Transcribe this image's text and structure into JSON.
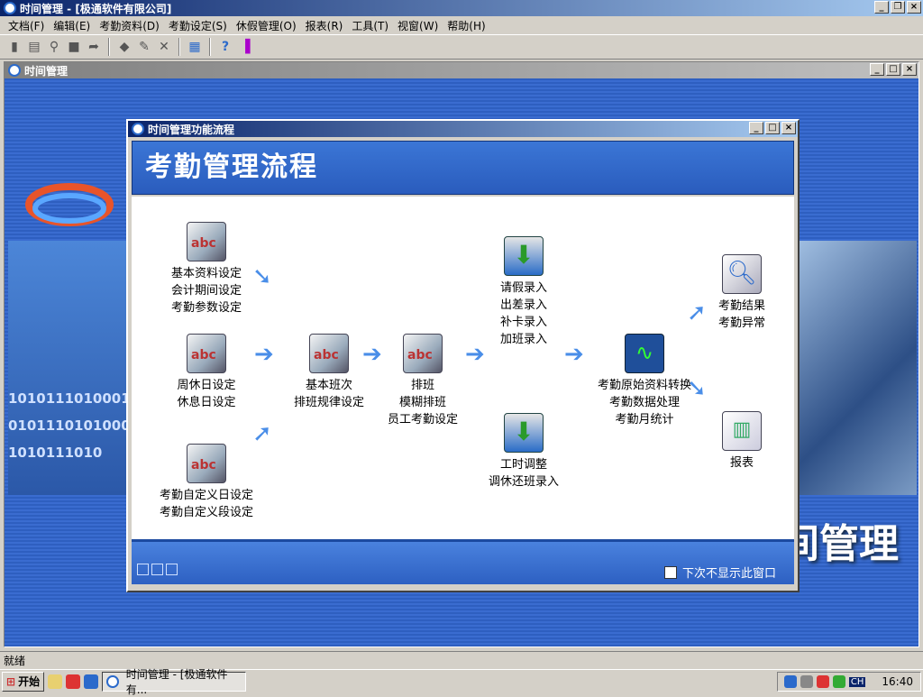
{
  "app": {
    "title": "时间管理 - [极通软件有限公司]"
  },
  "menu": [
    "文档(F)",
    "编辑(E)",
    "考勤资料(D)",
    "考勤设定(S)",
    "休假管理(O)",
    "报表(R)",
    "工具(T)",
    "视窗(W)",
    "帮助(H)"
  ],
  "mdi": {
    "title": "时间管理",
    "bg_text": "间管理",
    "binary": [
      "1010111010001",
      "0101110101000",
      "1010111010"
    ]
  },
  "dialog": {
    "title": "时间管理功能流程",
    "banner": "考勤管理流程",
    "nodes": {
      "basic": [
        "基本资料设定",
        "会计期间设定",
        "考勤参数设定"
      ],
      "weekly": [
        "周休日设定",
        "休息日设定"
      ],
      "custom": [
        "考勤自定义日设定",
        "考勤自定义段设定"
      ],
      "shift": [
        "基本班次",
        "排班规律设定"
      ],
      "schedule": [
        "排班",
        "模糊排班",
        "员工考勤设定"
      ],
      "leave": [
        "请假录入",
        "出差录入",
        "补卡录入",
        "加班录入"
      ],
      "adjust": [
        "工时调整",
        "调休还班录入"
      ],
      "process": [
        "考勤原始资料转换",
        "考勤数据处理",
        "考勤月统计"
      ],
      "result": [
        "考勤结果",
        "考勤异常"
      ],
      "report": [
        "报表"
      ]
    },
    "checkbox_label": "下次不显示此窗口"
  },
  "status": "就绪",
  "taskbar": {
    "start": "开始",
    "task": "时间管理 - [极通软件有...",
    "lang": "CH",
    "time": "16:40"
  },
  "colors": {
    "title": "#0a246a",
    "accent": "#2b6acb"
  }
}
